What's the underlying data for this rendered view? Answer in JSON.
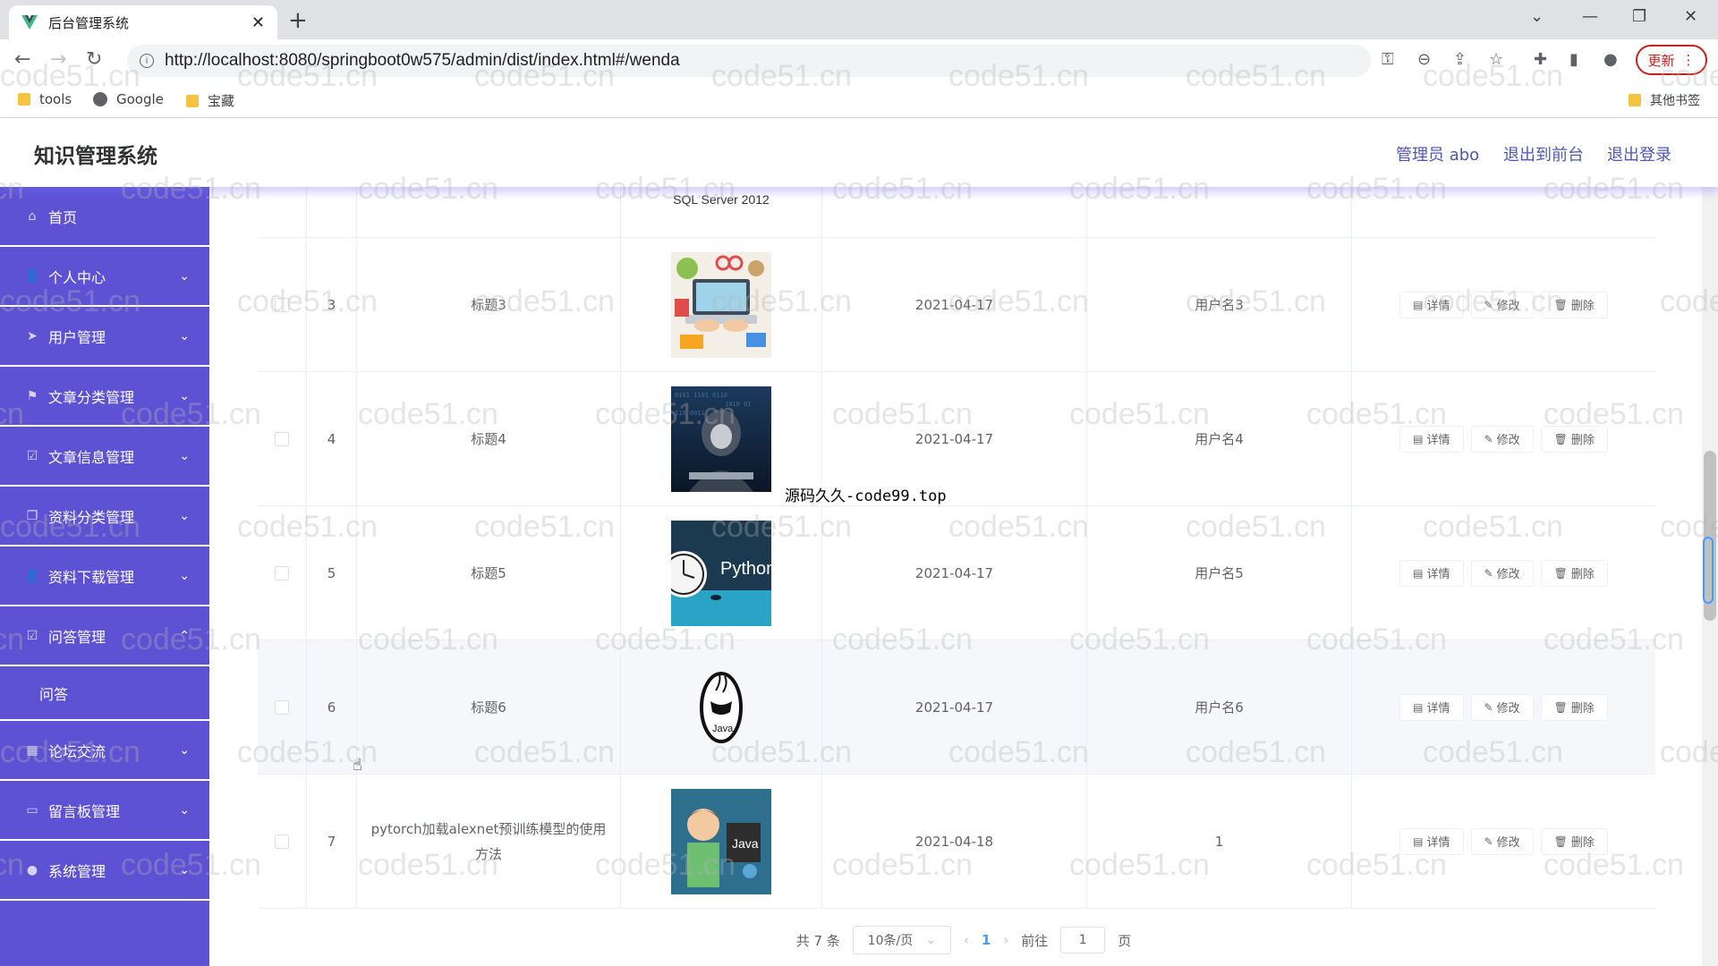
{
  "browser": {
    "tab_title": "后台管理系统",
    "url": "http://localhost:8080/springboot0w575/admin/dist/index.html#/wenda",
    "update_label": "更新",
    "bookmarks": [
      "tools",
      "Google",
      "宝藏"
    ],
    "other_bookmarks": "其他书签"
  },
  "header": {
    "title": "知识管理系统",
    "admin": "管理员 abo",
    "exit_front": "退出到前台",
    "logout": "退出登录"
  },
  "sidebar": {
    "items": [
      {
        "label": "首页",
        "icon": "home-icon"
      },
      {
        "label": "个人中心",
        "icon": "user-icon"
      },
      {
        "label": "用户管理",
        "icon": "send-icon"
      },
      {
        "label": "文章分类管理",
        "icon": "flag-icon"
      },
      {
        "label": "文章信息管理",
        "icon": "checkbox-icon"
      },
      {
        "label": "资料分类管理",
        "icon": "copy-icon"
      },
      {
        "label": "资料下载管理",
        "icon": "user-icon"
      },
      {
        "label": "问答管理",
        "icon": "checkbox-icon"
      },
      {
        "label": "论坛交流",
        "icon": "grid-icon"
      },
      {
        "label": "留言板管理",
        "icon": "monitor-icon"
      },
      {
        "label": "系统管理",
        "icon": "location-icon"
      }
    ],
    "submenu": "问答"
  },
  "table": {
    "top_image_caption": "SQL Server 2012",
    "rows": [
      {
        "index": "3",
        "title": "标题3",
        "date": "2021-04-17",
        "user": "用户名3",
        "image": "laptop-illustration"
      },
      {
        "index": "4",
        "title": "标题4",
        "date": "2021-04-17",
        "user": "用户名4",
        "image": "hacker-photo"
      },
      {
        "index": "5",
        "title": "标题5",
        "date": "2021-04-17",
        "user": "用户名5",
        "image": "python-clock"
      },
      {
        "index": "6",
        "title": "标题6",
        "date": "2021-04-17",
        "user": "用户名6",
        "image": "java-logo"
      },
      {
        "index": "7",
        "title": "pytorch加载alexnet预训练模型的使用方法",
        "date": "2021-04-18",
        "user": "1",
        "image": "java-cartoon"
      }
    ],
    "python_text": "Python",
    "java_text": "Java",
    "actions": {
      "detail": "详情",
      "edit": "修改",
      "delete": "删除"
    }
  },
  "pagination": {
    "total": "共 7 条",
    "page_size": "10条/页",
    "current": "1",
    "goto_label": "前往",
    "goto_value": "1",
    "page_label": "页"
  },
  "overlay_text": "源码久久-code99.top",
  "watermark": "code51.cn",
  "colors": {
    "sidebar": "#5d52d4",
    "header_link": "#4c57b5",
    "page_active": "#409eff"
  }
}
